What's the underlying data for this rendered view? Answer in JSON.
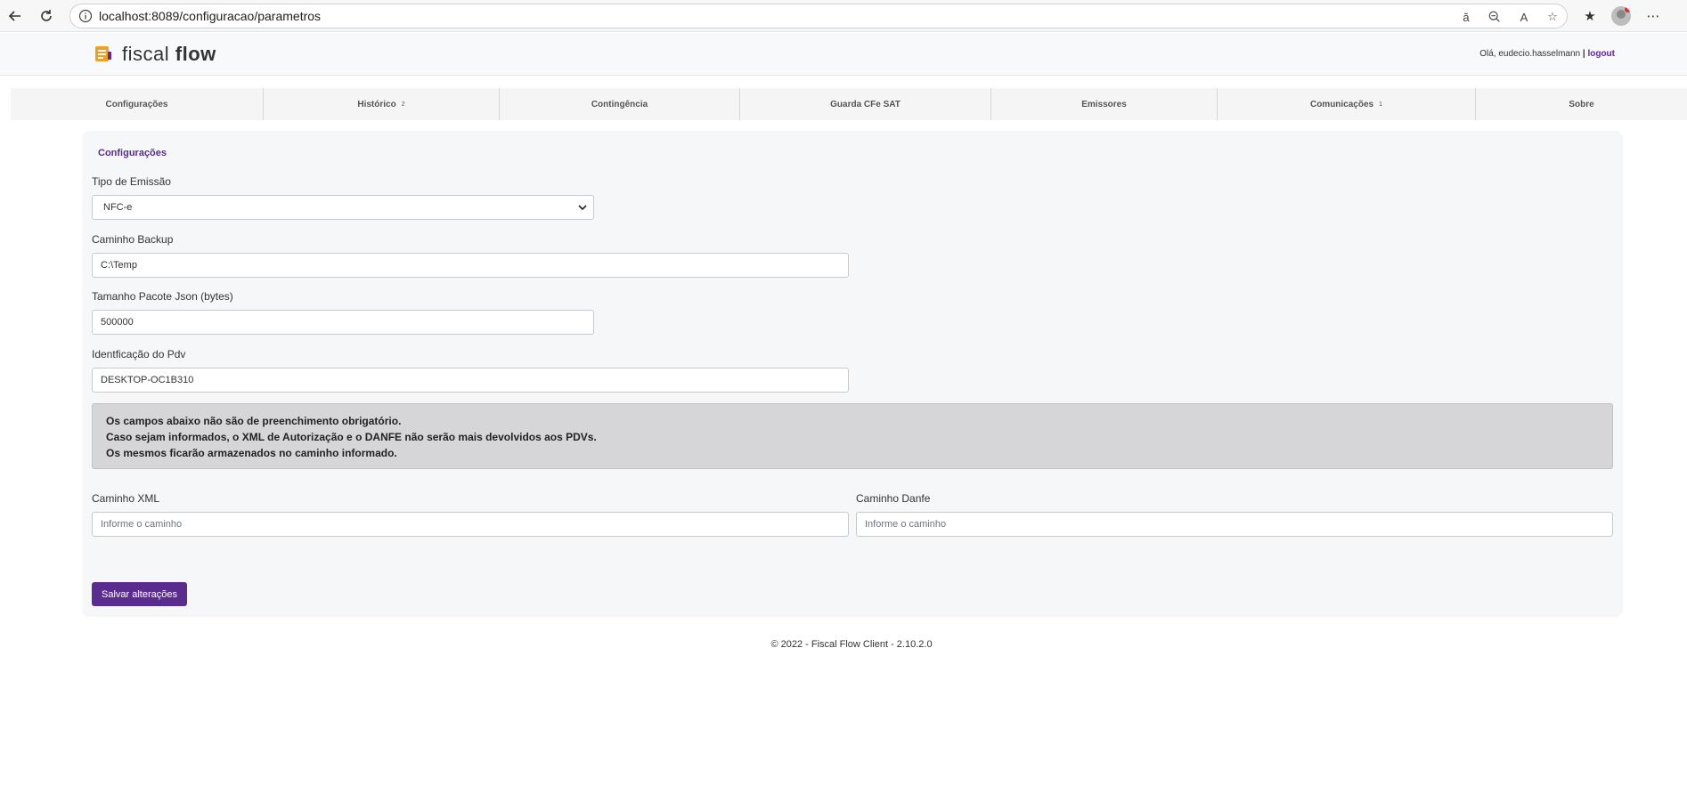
{
  "browser": {
    "url": "localhost:8089/configuracao/parametros"
  },
  "header": {
    "logo_light": "fiscal ",
    "logo_bold": "flow",
    "greeting": "Olá, eudecio.hasselmann",
    "separator": " | ",
    "logout": "logout"
  },
  "nav": {
    "items": [
      {
        "label": "Configurações",
        "badge": ""
      },
      {
        "label": "Histórico",
        "badge": "2"
      },
      {
        "label": "Contingência",
        "badge": ""
      },
      {
        "label": "Guarda CFe SAT",
        "badge": ""
      },
      {
        "label": "Emissores",
        "badge": ""
      },
      {
        "label": "Comunicações",
        "badge": "1"
      },
      {
        "label": "Sobre",
        "badge": ""
      }
    ]
  },
  "form": {
    "section_title": "Configurações",
    "tipo_emissao": {
      "label": "Tipo de Emissão",
      "value": "NFC-e"
    },
    "caminho_backup": {
      "label": "Caminho Backup",
      "value": "C:\\Temp"
    },
    "tamanho_pacote": {
      "label": "Tamanho Pacote Json (bytes)",
      "value": "500000"
    },
    "identificacao_pdv": {
      "label": "Identficação do Pdv",
      "value": "DESKTOP-OC1B310"
    },
    "notice": {
      "line1": "Os campos abaixo não são de preenchimento obrigatório.",
      "line2": "Caso sejam informados, o XML de Autorização e o DANFE não serão mais devolvidos aos PDVs.",
      "line3": "Os mesmos ficarão armazenados no caminho informado."
    },
    "caminho_xml": {
      "label": "Caminho XML",
      "placeholder": "Informe o caminho"
    },
    "caminho_danfe": {
      "label": "Caminho Danfe",
      "placeholder": "Informe o caminho"
    },
    "save_label": "Salvar alterações"
  },
  "footer": {
    "text": "© 2022 - Fiscal Flow Client - 2.10.2.0"
  },
  "colors": {
    "brand": "#5b2c8f",
    "logo_orange": "#f0a020"
  }
}
